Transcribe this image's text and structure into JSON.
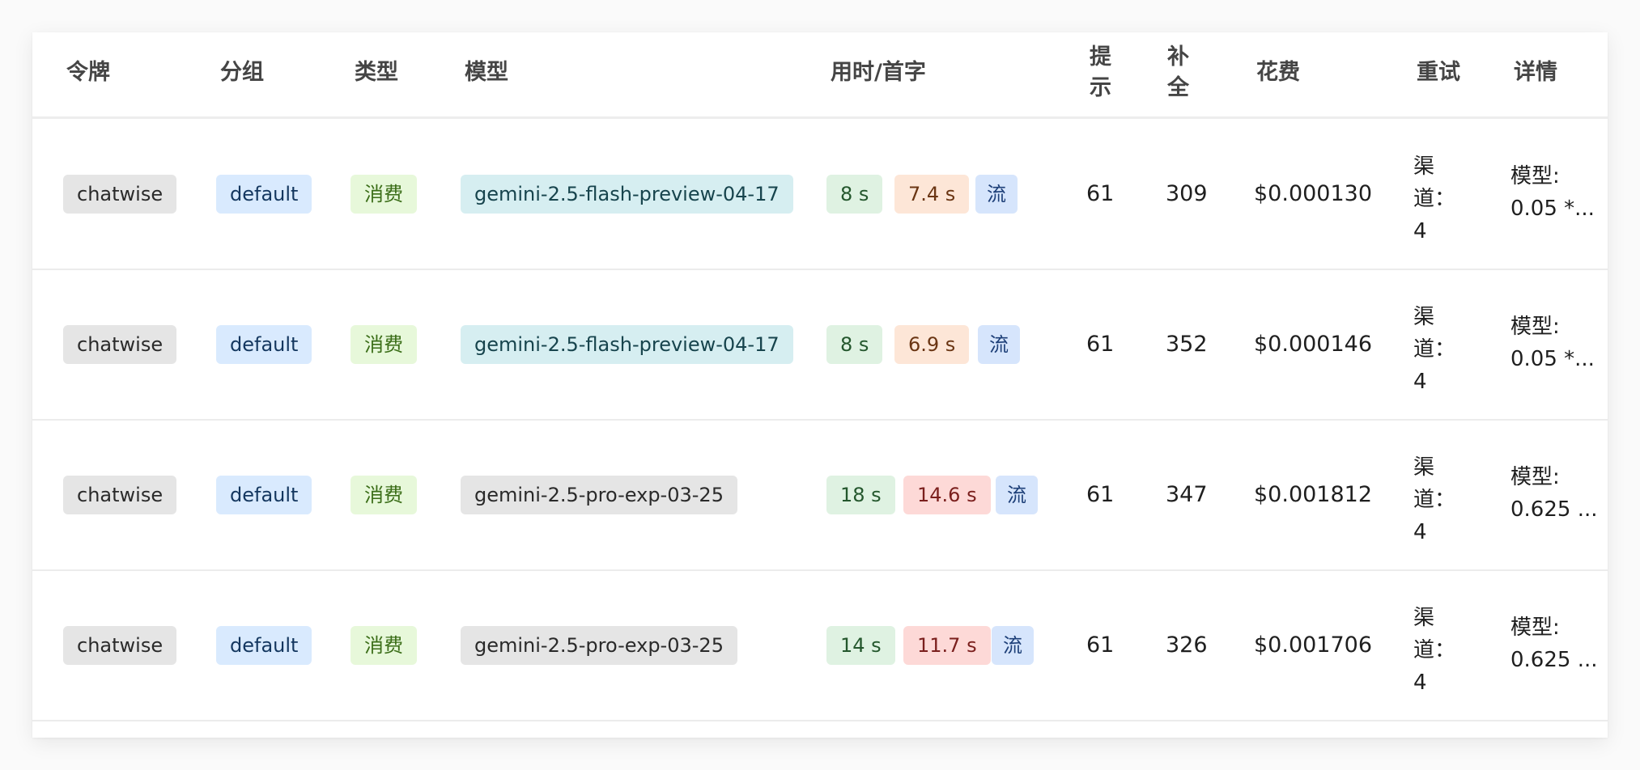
{
  "table": {
    "headers": {
      "token": "令牌",
      "group": "分组",
      "type": "类型",
      "model": "模型",
      "time": "用时/首字",
      "prompt": "提示",
      "completion": "补全",
      "cost": "花费",
      "retry": "重试",
      "detail": "详情"
    },
    "rows": [
      {
        "token": "chatwise",
        "group": "default",
        "type": "消费",
        "model": "gemini-2.5-flash-preview-04-17",
        "time": "8 s",
        "first": "7.4 s",
        "stream": "流",
        "prompt": "61",
        "completion": "309",
        "cost": "$0.000130",
        "retry": "渠道：4",
        "detail_l1": "模型:",
        "detail_l2": "0.05 *..."
      },
      {
        "token": "chatwise",
        "group": "default",
        "type": "消费",
        "model": "gemini-2.5-flash-preview-04-17",
        "time": "8 s",
        "first": "6.9 s",
        "stream": "流",
        "prompt": "61",
        "completion": "352",
        "cost": "$0.000146",
        "retry": "渠道：4",
        "detail_l1": "模型:",
        "detail_l2": "0.05 *..."
      },
      {
        "token": "chatwise",
        "group": "default",
        "type": "消费",
        "model": "gemini-2.5-pro-exp-03-25",
        "time": "18 s",
        "first": "14.6 s",
        "stream": "流",
        "prompt": "61",
        "completion": "347",
        "cost": "$0.001812",
        "retry": "渠道：4",
        "detail_l1": "模型:",
        "detail_l2": "0.625 ..."
      },
      {
        "token": "chatwise",
        "group": "default",
        "type": "消费",
        "model": "gemini-2.5-pro-exp-03-25",
        "time": "14 s",
        "first": "11.7 s",
        "stream": "流",
        "prompt": "61",
        "completion": "326",
        "cost": "$0.001706",
        "retry": "渠道：4",
        "detail_l1": "模型:",
        "detail_l2": "0.625 ..."
      }
    ]
  },
  "colors": {
    "token_tag": "#e5e5e5",
    "group_tag": "#d9eafe",
    "type_tag": "#e7f8da",
    "flash_model_tag": "#d6eef1",
    "pro_model_tag": "#e5e5e5",
    "time_tag": "#dff2e2",
    "first_byte_fast": "#fde6d7",
    "first_byte_slow": "#fdd9d7",
    "stream_tag": "#d6e5fc"
  }
}
